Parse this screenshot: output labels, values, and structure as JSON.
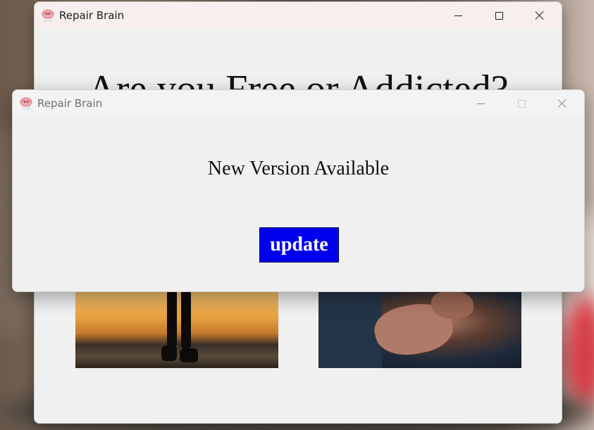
{
  "main_window": {
    "title": "Repair Brain",
    "heading": "Are you Free or Addicted?",
    "controls": {
      "minimize": "minimize-icon",
      "maximize": "maximize-icon",
      "close": "close-icon"
    }
  },
  "dialog": {
    "title": "Repair Brain",
    "message": "New Version Available",
    "update_label": "update",
    "controls": {
      "minimize": "minimize-icon",
      "maximize": "maximize-icon",
      "close": "close-icon"
    }
  },
  "colors": {
    "update_button_bg": "#0000ee",
    "update_button_text": "#ffffff",
    "window_bg": "#f0f0f0"
  },
  "icons": {
    "app": "brain-icon"
  }
}
